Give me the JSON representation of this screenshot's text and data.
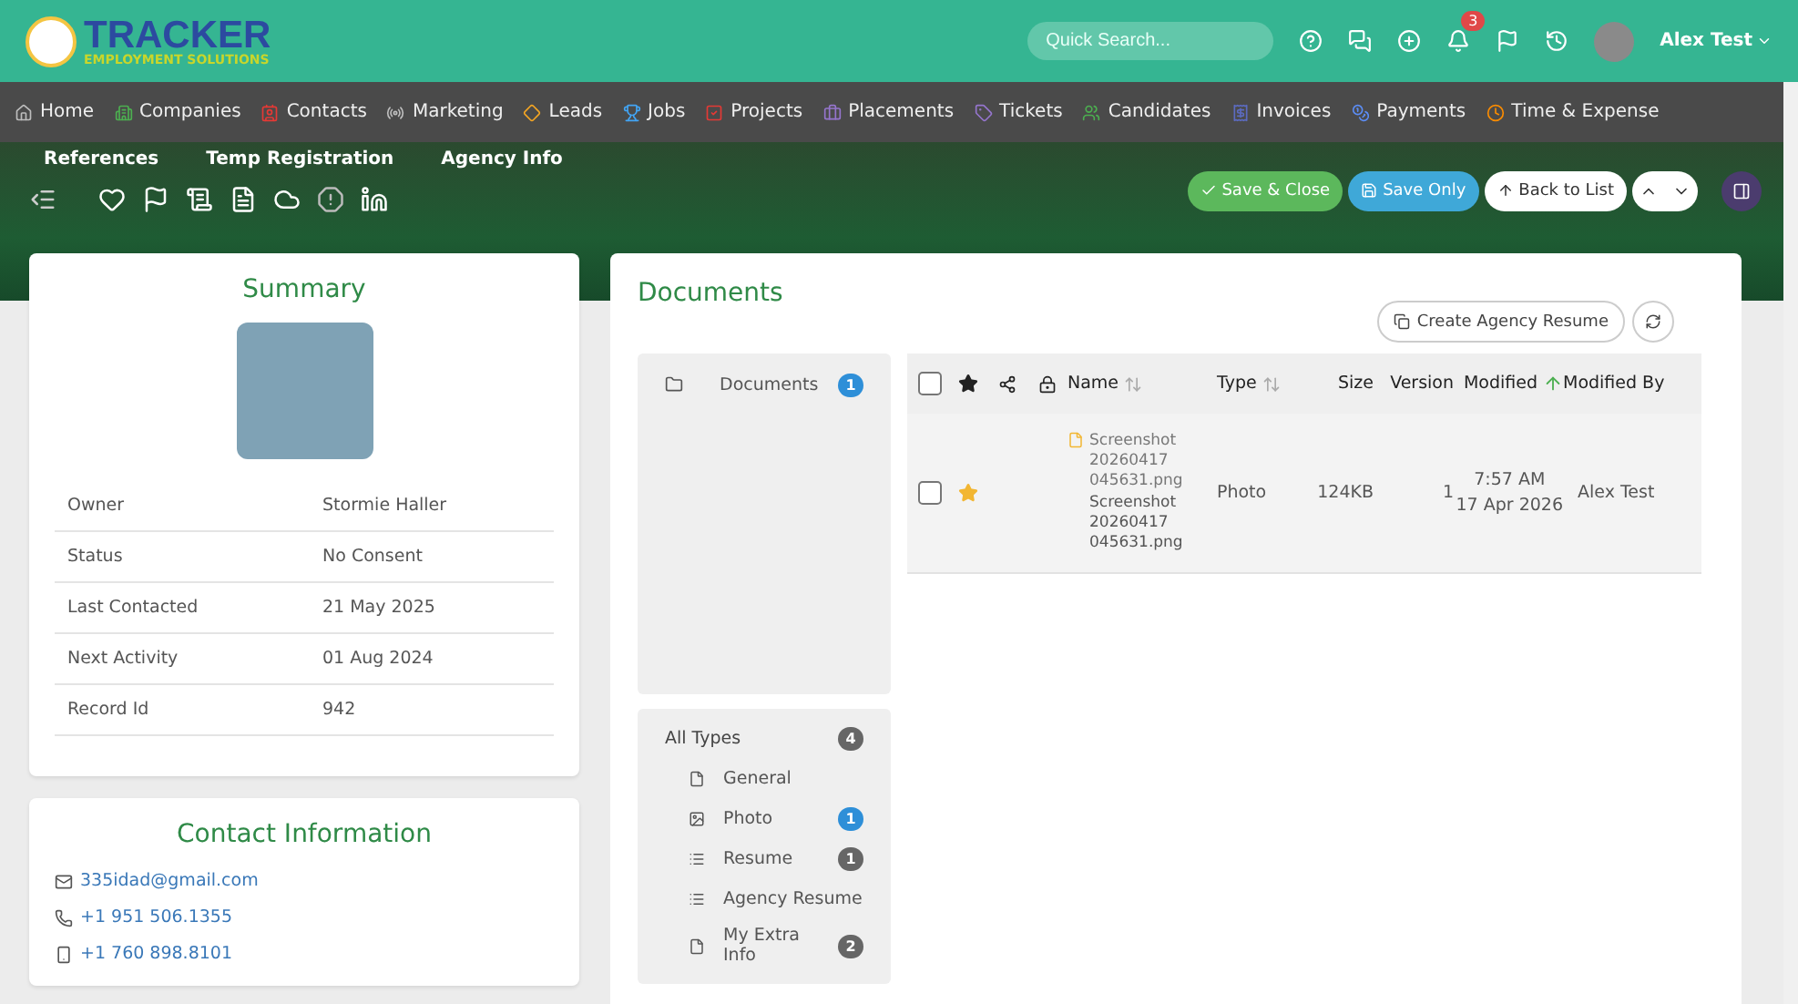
{
  "header": {
    "logo_title": "TRACKER",
    "logo_subtitle": "EMPLOYMENT SOLUTIONS",
    "search": {
      "placeholder": "Quick Search..."
    },
    "notification_count": "3",
    "user": "Alex Test"
  },
  "nav": {
    "items": [
      {
        "label": "Home",
        "color": "#bdbdbd"
      },
      {
        "label": "Companies",
        "color": "#4caf50"
      },
      {
        "label": "Contacts",
        "color": "#e53935"
      },
      {
        "label": "Marketing",
        "color": "#bdbdbd"
      },
      {
        "label": "Leads",
        "color": "#f5a623"
      },
      {
        "label": "Jobs",
        "color": "#42a5f5"
      },
      {
        "label": "Projects",
        "color": "#e53935"
      },
      {
        "label": "Placements",
        "color": "#9575cd"
      },
      {
        "label": "Tickets",
        "color": "#9575cd"
      },
      {
        "label": "Candidates",
        "color": "#4caf50"
      },
      {
        "label": "Invoices",
        "color": "#5c6bc0"
      },
      {
        "label": "Payments",
        "color": "#5c8df5"
      },
      {
        "label": "Time & Expense",
        "color": "#fb8c00"
      }
    ],
    "second_row": [
      "References",
      "Temp Registration",
      "Agency Info"
    ]
  },
  "actions": [
    {
      "label": "Save & Close",
      "kind": "success"
    },
    {
      "label": "Save Only",
      "kind": "info"
    },
    {
      "label": "Back to List",
      "kind": "plain"
    }
  ],
  "summary": {
    "title": "Summary",
    "fields": [
      {
        "label": "Owner",
        "value": "Stormie Haller"
      },
      {
        "label": "Status",
        "value": "No Consent"
      },
      {
        "label": "Last Contacted",
        "value": "21 May 2025"
      },
      {
        "label": "Next Activity",
        "value": "01 Aug 2024"
      },
      {
        "label": "Record Id",
        "value": "942"
      }
    ]
  },
  "contact": {
    "title": "Contact Information",
    "items": [
      {
        "kind": "email",
        "value": "335idad@gmail.com"
      },
      {
        "kind": "phone",
        "value": "+1 951 506.1355"
      },
      {
        "kind": "mobile",
        "value": "+1 760 898.8101"
      }
    ]
  },
  "documents": {
    "title": "Documents",
    "create_button": "Create Agency Resume",
    "folders": [
      {
        "label": "Documents",
        "count": "1",
        "color": "#2e8fd8"
      }
    ],
    "types_header": {
      "label": "All Types",
      "count": "4",
      "color": "#666666"
    },
    "types": [
      {
        "label": "General"
      },
      {
        "label": "Photo",
        "count": "1",
        "color": "#2e8fd8"
      },
      {
        "label": "Resume",
        "count": "1",
        "color": "#666666"
      },
      {
        "label": "Agency Resume"
      },
      {
        "label": "My Extra Info",
        "count": "2",
        "color": "#666666"
      }
    ],
    "table": {
      "all_selected": false,
      "columns": [
        {
          "label": "Name",
          "sortable": true,
          "sorted_ascending": false
        },
        {
          "label": "Type",
          "sortable": true,
          "sorted_ascending": false
        },
        {
          "label": "Size"
        },
        {
          "label": "Version"
        },
        {
          "label": "Modified",
          "sortable": true,
          "sorted_ascending": true
        },
        {
          "label": "Modified By"
        }
      ],
      "rows": [
        {
          "checked": false,
          "starred": true,
          "name": "Screenshot 20260417 045631.png",
          "file_name": "Screenshot 20260417 045631.png",
          "type": "Photo",
          "size": "124KB",
          "version": "1",
          "modified_time": "7:57 AM",
          "modified_date": "17 Apr 2026",
          "modified_by": "Alex Test"
        }
      ]
    }
  }
}
